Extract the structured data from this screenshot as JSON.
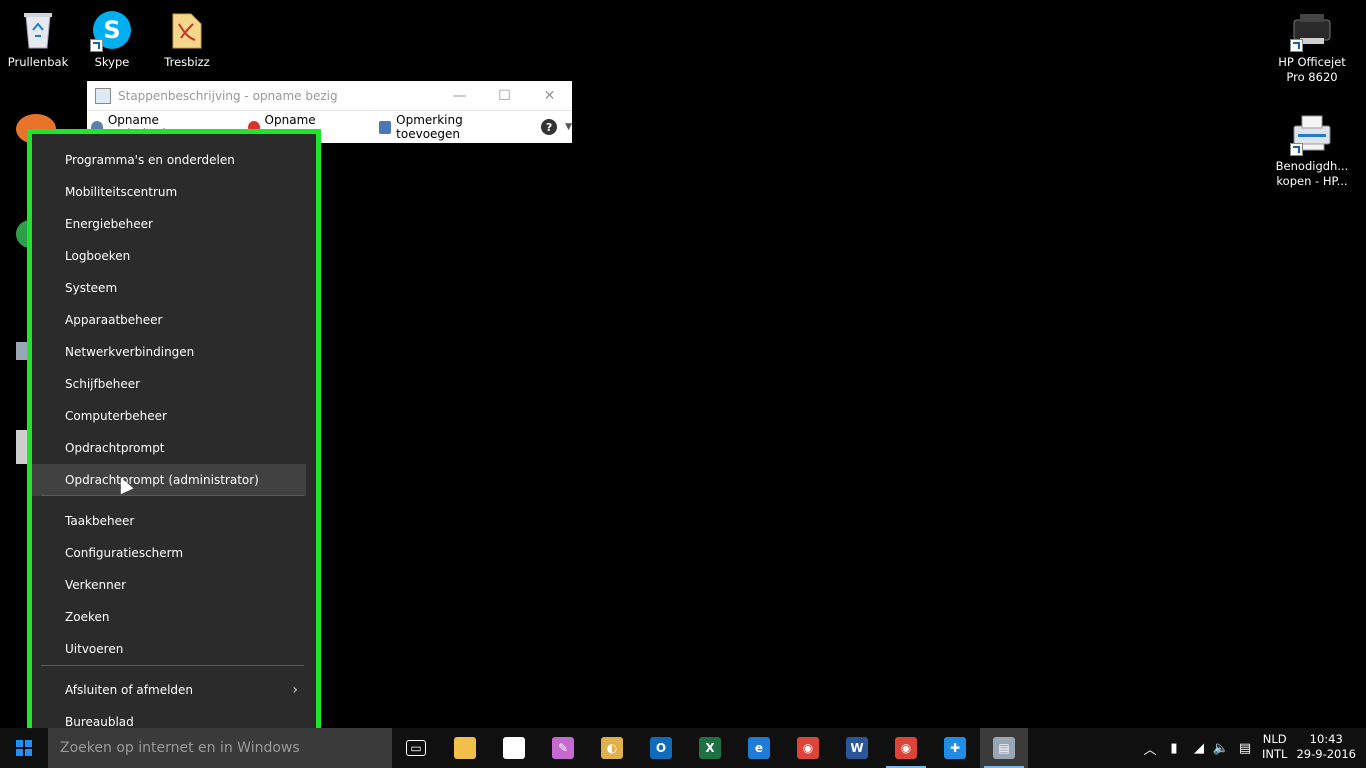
{
  "desktop": {
    "icons": [
      {
        "label": "Prullenbak",
        "icon": "recycle-bin-icon"
      },
      {
        "label": "Skype",
        "icon": "skype-icon"
      },
      {
        "label": "Tresbizz",
        "icon": "pdf-file-icon"
      },
      {
        "label": "HP Officejet Pro 8620",
        "icon": "printer-icon"
      },
      {
        "label": "Benodigdh... kopen - HP...",
        "icon": "printer-shop-icon"
      }
    ]
  },
  "psr_window": {
    "title": "Stappenbeschrijving - opname bezig",
    "tools": [
      {
        "label": "Opname onderbreken",
        "icon": "pause-icon",
        "color": "#5a7fa8"
      },
      {
        "label": "Opname stoppen",
        "icon": "stop-icon",
        "color": "#d9342b"
      },
      {
        "label": "Opmerking toevoegen",
        "icon": "comment-icon",
        "color": "#4a77b5"
      }
    ],
    "minimize": "—",
    "maximize": "☐",
    "close": "✕",
    "help": "?"
  },
  "context_menu": {
    "group1": [
      "Programma's en onderdelen",
      "Mobiliteitscentrum",
      "Energiebeheer",
      "Logboeken",
      "Systeem",
      "Apparaatbeheer",
      "Netwerkverbindingen",
      "Schijfbeheer",
      "Computerbeheer",
      "Opdrachtprompt",
      "Opdrachtprompt (administrator)"
    ],
    "group2": [
      "Taakbeheer",
      "Configuratiescherm",
      "Verkenner",
      "Zoeken",
      "Uitvoeren"
    ],
    "group3": [
      "Afsluiten of afmelden",
      "Bureaublad"
    ],
    "highlight_color": "#1fe52b"
  },
  "taskbar": {
    "search_placeholder": "Zoeken op internet en in Windows",
    "apps": [
      {
        "name": "task-view-icon",
        "glyph": "▭",
        "color": "#101010"
      },
      {
        "name": "file-explorer-icon",
        "glyph": "",
        "color": "#f0c04a"
      },
      {
        "name": "store-icon",
        "glyph": "▣",
        "color": "#ffffff"
      },
      {
        "name": "paint-tool-icon",
        "glyph": "✎",
        "color": "#c46ad0"
      },
      {
        "name": "paint-icon",
        "glyph": "◐",
        "color": "#e0b04a"
      },
      {
        "name": "outlook-icon",
        "glyph": "O",
        "color": "#0f6cbd"
      },
      {
        "name": "excel-icon",
        "glyph": "X",
        "color": "#1e7145"
      },
      {
        "name": "edge-icon",
        "glyph": "e",
        "color": "#1e7bd6"
      },
      {
        "name": "chrome-icon",
        "glyph": "◉",
        "color": "#db4437"
      },
      {
        "name": "word-icon",
        "glyph": "W",
        "color": "#2b579a"
      },
      {
        "name": "chrome-2-icon",
        "glyph": "◉",
        "color": "#db4437"
      },
      {
        "name": "teamviewer-icon",
        "glyph": "✚",
        "color": "#1f8ce6"
      },
      {
        "name": "steps-recorder-icon",
        "glyph": "▤",
        "color": "#9aa6b4"
      }
    ],
    "language": "NLD",
    "keyboard": "INTL",
    "time": "10:43",
    "date": "29-9-2016"
  }
}
